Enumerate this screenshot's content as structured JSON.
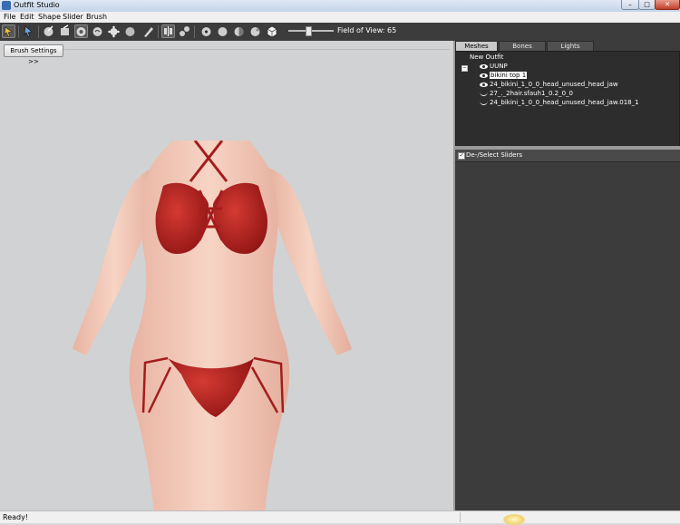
{
  "window": {
    "title": "Outfit Studio"
  },
  "menu": [
    "File",
    "Edit",
    "Shape",
    "Slider",
    "Brush"
  ],
  "toolbar": {
    "tools": [
      "select-tool-icon",
      "transform-tool-icon",
      "standard-brush-icon",
      "deflate-brush-icon",
      "move-brush-icon",
      "smooth-brush-icon",
      "mask-brush-icon",
      "unmask-brush-icon",
      "inflate-brush-icon",
      "weight-brush-icon",
      "color-brush-icon",
      "mirror-x-icon",
      "connected-icon",
      "vertex-icon",
      "wireframe-icon",
      "lighting-icon",
      "texture-icon",
      "cube-icon"
    ],
    "fov_label": "Field of View: 65",
    "fov_value": 65
  },
  "viewport": {
    "brush_settings_label": "Brush Settings >>"
  },
  "tabs": [
    "Meshes",
    "Bones",
    "Lights"
  ],
  "mesh_tree": {
    "root": "New Outfit",
    "items": [
      {
        "label": "UUNP",
        "visible": true,
        "selected": false
      },
      {
        "label": "bikini top 1",
        "visible": true,
        "selected": true
      },
      {
        "label": "24_bikini_1_0_0_head_unused_head_jaw",
        "visible": true,
        "selected": false
      },
      {
        "label": "27_._2hair.sfauh1_0.2_0_0",
        "visible": false,
        "selected": false
      },
      {
        "label": "24_bikini_1_0_0_head_unused_head_jaw.018_1",
        "visible": false,
        "selected": false
      }
    ]
  },
  "sliders": {
    "header_label": "De-/Select Sliders",
    "checked": true
  },
  "status": {
    "text": "Ready!"
  },
  "colors": {
    "skin": "#f2c7b4",
    "bikini": "#b52020",
    "viewport_bg": "#d0d2d3",
    "panel_bg": "#3c3c3c"
  }
}
